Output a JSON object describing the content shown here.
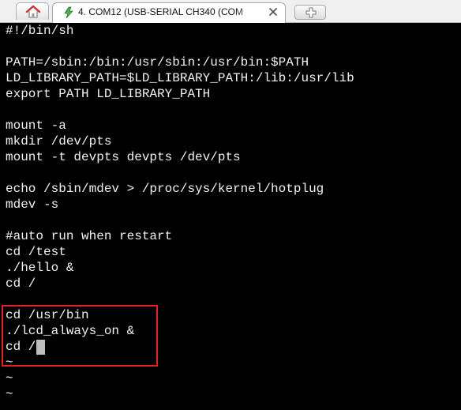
{
  "tabs": {
    "home_icon": "home-icon",
    "active_tab": {
      "title": "4. COM12  (USB-SERIAL CH340 (COM",
      "icon": "serial-connection-icon"
    },
    "close_icon": "close-icon",
    "new_tab_icon": "plus-icon"
  },
  "terminal": {
    "lines": [
      "#!/bin/sh",
      "",
      "PATH=/sbin:/bin:/usr/sbin:/usr/bin:$PATH",
      "LD_LIBRARY_PATH=$LD_LIBRARY_PATH:/lib:/usr/lib",
      "export PATH LD_LIBRARY_PATH",
      "",
      "mount -a",
      "mkdir /dev/pts",
      "mount -t devpts devpts /dev/pts",
      "",
      "echo /sbin/mdev > /proc/sys/kernel/hotplug",
      "mdev -s",
      "",
      "#auto run when restart",
      "cd /test",
      "./hello &",
      "cd /",
      "",
      "cd /usr/bin",
      "./lcd_always_on &",
      "cd /",
      "~",
      "~",
      "~"
    ],
    "cursor_line": 20,
    "highlight_color": "#e32222",
    "background_color": "#000000",
    "text_color": "#f2f2f2"
  }
}
